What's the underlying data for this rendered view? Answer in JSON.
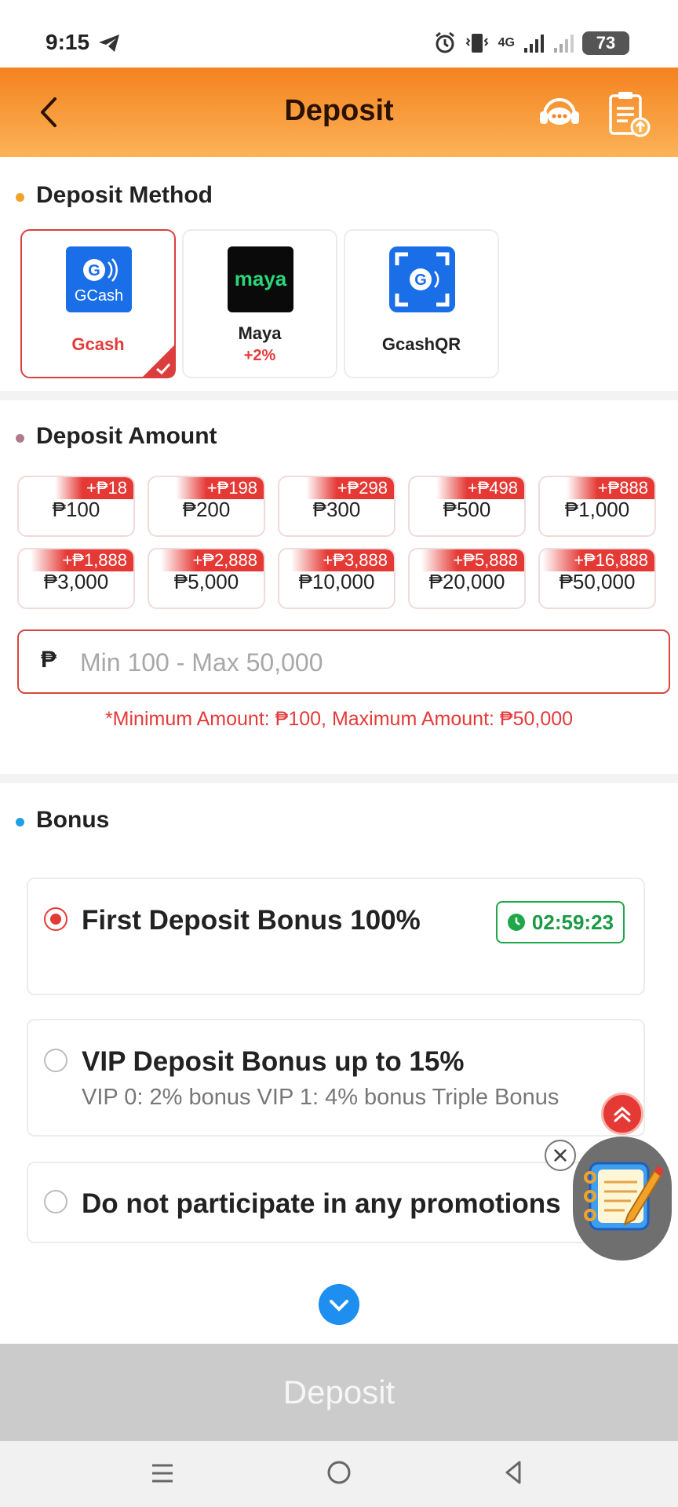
{
  "status_bar": {
    "time": "9:15",
    "network": "4G",
    "battery": "73"
  },
  "header": {
    "title": "Deposit"
  },
  "deposit_method": {
    "section_title": "Deposit Method",
    "methods": [
      {
        "name": "Gcash",
        "logo_text": "GCash",
        "bonus": "",
        "selected": true
      },
      {
        "name": "Maya",
        "logo_text": "maya",
        "bonus": "+2%",
        "selected": false
      },
      {
        "name": "GcashQR",
        "logo_text": "",
        "bonus": "",
        "selected": false
      }
    ]
  },
  "deposit_amount": {
    "section_title": "Deposit Amount",
    "chips": [
      {
        "badge": "+₱18",
        "amount": "₱100"
      },
      {
        "badge": "+₱198",
        "amount": "₱200"
      },
      {
        "badge": "+₱298",
        "amount": "₱300"
      },
      {
        "badge": "+₱498",
        "amount": "₱500"
      },
      {
        "badge": "+₱888",
        "amount": "₱1,000"
      },
      {
        "badge": "+₱1,888",
        "amount": "₱3,000"
      },
      {
        "badge": "+₱2,888",
        "amount": "₱5,000"
      },
      {
        "badge": "+₱3,888",
        "amount": "₱10,000"
      },
      {
        "badge": "+₱5,888",
        "amount": "₱20,000"
      },
      {
        "badge": "+₱16,888",
        "amount": "₱50,000"
      }
    ],
    "currency_symbol": "₱",
    "input_value": "",
    "input_placeholder": "Min 100 - Max 50,000",
    "limit_note": "*Minimum Amount: ₱100, Maximum Amount: ₱50,000"
  },
  "bonus": {
    "section_title": "Bonus",
    "options": [
      {
        "title": "First Deposit Bonus 100%",
        "subtitle": "",
        "timer": "02:59:23",
        "selected": true
      },
      {
        "title": "VIP Deposit Bonus up to 15%",
        "subtitle": "VIP 0: 2% bonus VIP 1: 4% bonus Triple Bonus",
        "timer": "",
        "selected": false
      },
      {
        "title": "Do not participate in any promotions",
        "subtitle": "",
        "timer": "",
        "selected": false
      }
    ]
  },
  "deposit_button": {
    "label": "Deposit"
  },
  "colors": {
    "header_start": "#f4821f",
    "header_end": "#fbb356",
    "accent_red": "#e53935",
    "timer_green": "#1fa84a",
    "button_disabled": "#cbcbcb"
  }
}
